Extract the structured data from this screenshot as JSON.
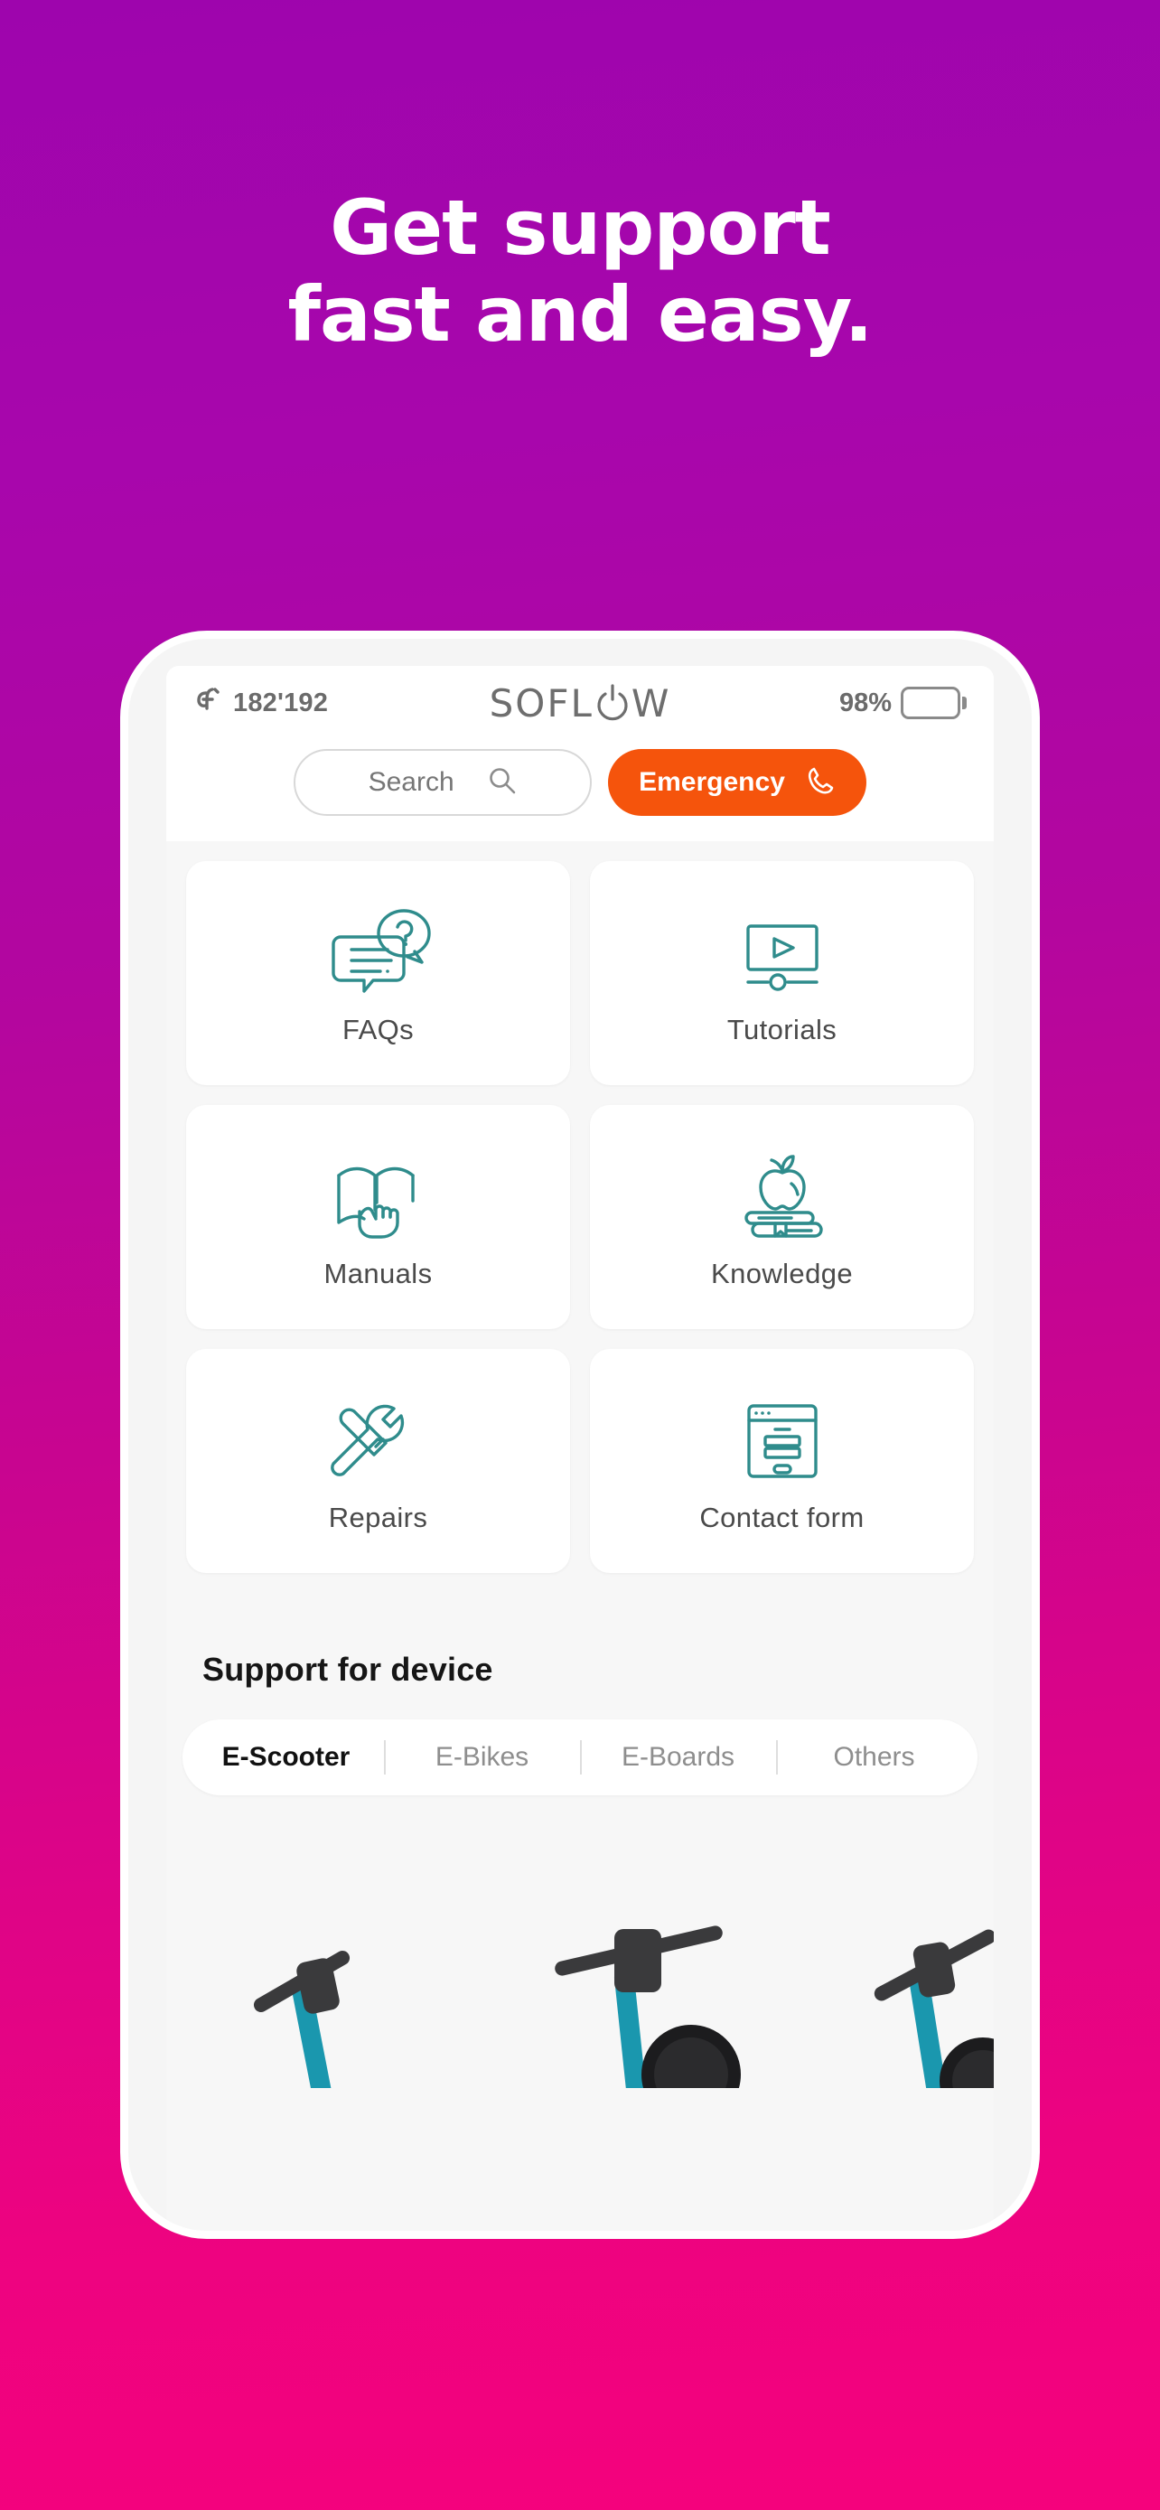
{
  "promo": {
    "headline_line1": "Get support",
    "headline_line2": "fast and easy.",
    "bg_start": "#9e05ad",
    "bg_end": "#f5027c"
  },
  "app": {
    "statusbar": {
      "odometer_icon": "soflow-mark-icon",
      "odometer_value": "182'192",
      "brand_part1": "SOFL",
      "brand_power_icon": "power-icon",
      "brand_part2": "W",
      "battery_percent": "98%",
      "battery_level": 98,
      "battery_color": "#19dd71"
    },
    "search": {
      "placeholder": "Search",
      "value": "",
      "icon": "search-icon"
    },
    "emergency": {
      "label": "Emergency",
      "icon": "phone-icon",
      "color": "#f5540c"
    },
    "tiles": [
      {
        "id": "faqs",
        "label": "FAQs",
        "icon": "chat-question-icon"
      },
      {
        "id": "tutorials",
        "label": "Tutorials",
        "icon": "video-play-icon"
      },
      {
        "id": "manuals",
        "label": "Manuals",
        "icon": "open-book-hand-icon"
      },
      {
        "id": "knowledge",
        "label": "Knowledge",
        "icon": "apple-books-icon"
      },
      {
        "id": "repairs",
        "label": "Repairs",
        "icon": "wrench-screwdriver-icon"
      },
      {
        "id": "contact-form",
        "label": "Contact form",
        "icon": "browser-form-icon"
      }
    ],
    "device_section": {
      "title": "Support for device",
      "tabs": [
        {
          "label": "E-Scooter",
          "active": true
        },
        {
          "label": "E-Bikes",
          "active": false
        },
        {
          "label": "E-Boards",
          "active": false
        },
        {
          "label": "Others",
          "active": false
        }
      ]
    },
    "icon_color": "#2f8c8c"
  }
}
